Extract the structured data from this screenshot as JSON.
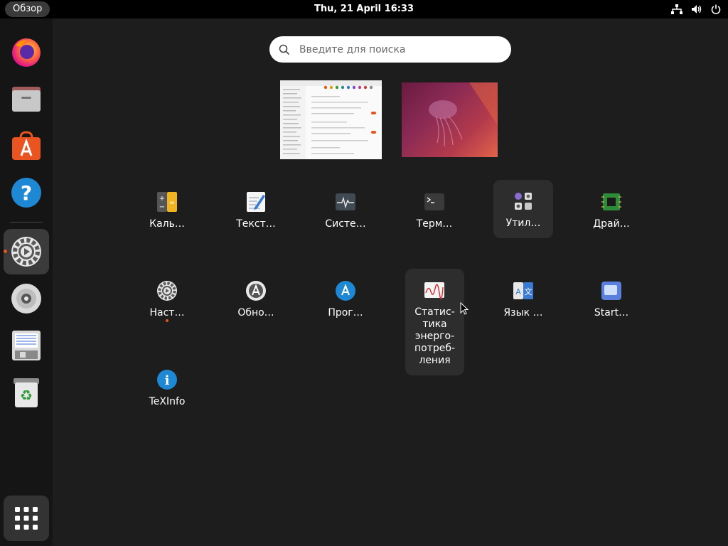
{
  "topbar": {
    "activities_label": "Обзор",
    "clock": "Thu, 21 April  16:33",
    "icons": [
      "network-icon",
      "volume-icon",
      "power-icon"
    ]
  },
  "dock": {
    "items": [
      {
        "name": "firefox-icon"
      },
      {
        "name": "files-icon"
      },
      {
        "name": "app-center-icon"
      },
      {
        "name": "help-icon"
      },
      {
        "name": "settings-icon",
        "active": true
      },
      {
        "name": "disc-icon"
      },
      {
        "name": "text-editor-icon"
      },
      {
        "name": "trash-icon"
      }
    ],
    "show_apps_icon": "grid-icon"
  },
  "search": {
    "placeholder": "Введите для поиска"
  },
  "apps": {
    "calculator": "Каль…",
    "text_editor": "Текст…",
    "system_monitor": "Систе…",
    "terminal": "Терм…",
    "utilities": "Утил…",
    "drivers": "Драй…",
    "settings": "Наст…",
    "updates": "Обно…",
    "software": "Прог…",
    "power_stats": "Статис-\nтика\nэнерго-\nпотреб-\nления",
    "language": "Язык …",
    "startup": "Start…",
    "texinfo": "TeXInfo"
  },
  "colors": {
    "accent": "#e95420",
    "background": "#1d1d1d",
    "topbar": "#000000",
    "dock": "#151515"
  }
}
